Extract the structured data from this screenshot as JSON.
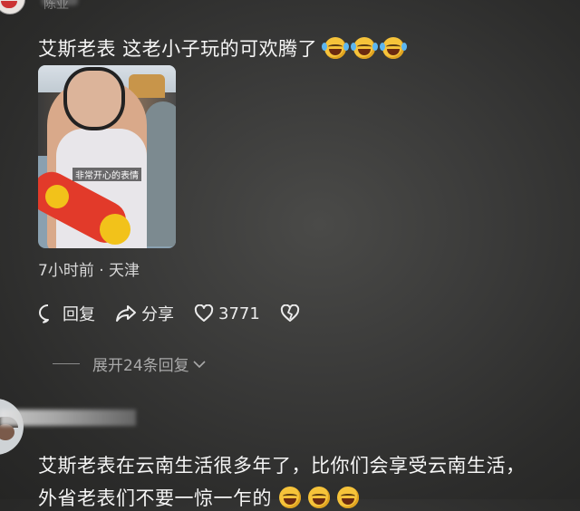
{
  "comment1": {
    "username": "陈亚",
    "text": "艾斯老表  这老小子玩的可欢腾了",
    "emojis": [
      "laughing-tears-emoji",
      "laughing-tears-emoji",
      "laughing-tears-emoji"
    ],
    "image_caption": "非常开心的表情",
    "meta": "7小时前 · 天津",
    "reply_label": "回复",
    "share_label": "分享",
    "like_count": "3771",
    "expand_label": "展开24条回复"
  },
  "comment2": {
    "text_line1": "艾斯老表在云南生活很多年了，比你们会享受云南生活，",
    "text_line2": "外省老表们不要一惊一乍的",
    "emojis": [
      "grimace-emoji",
      "grimace-emoji",
      "grimace-emoji"
    ]
  },
  "colors": {
    "background": "#3a3a39",
    "text_primary": "#f2f2f2",
    "text_secondary": "#a9a9a9",
    "emoji_yellow": "#f6c33a"
  }
}
